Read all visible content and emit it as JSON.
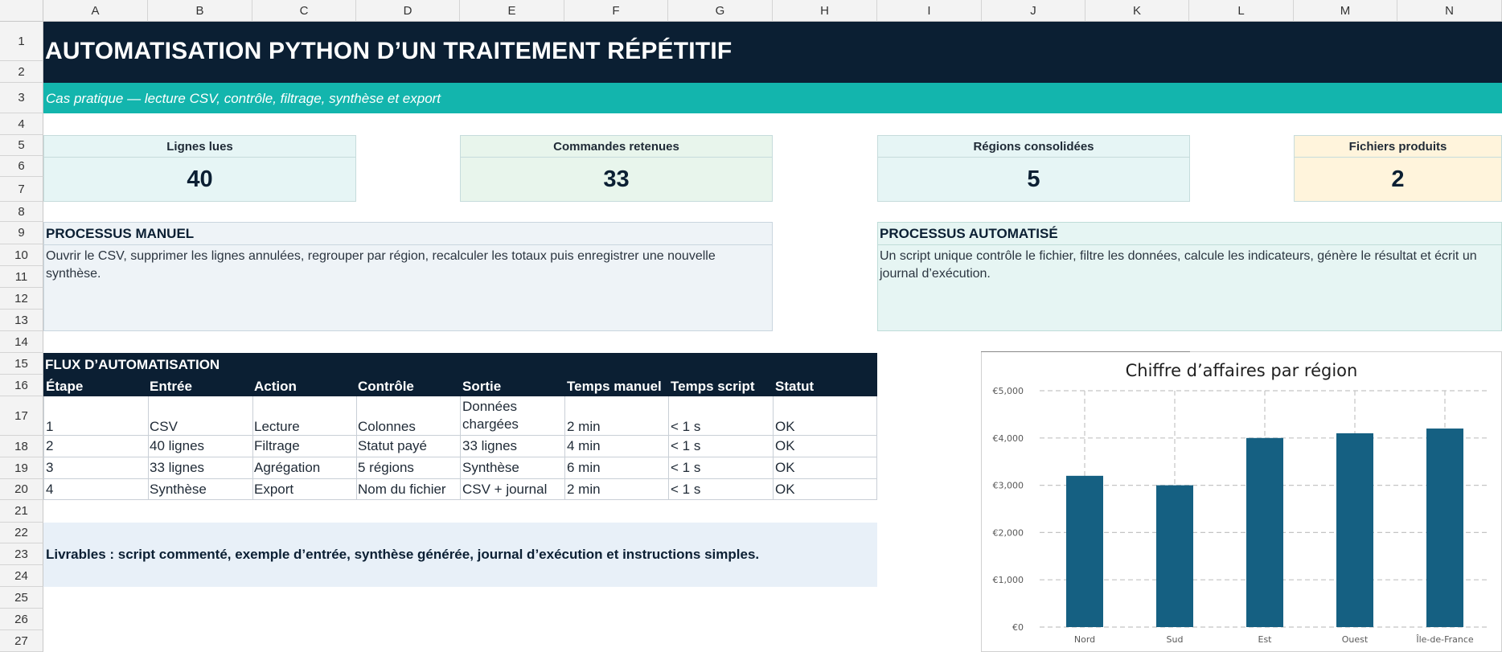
{
  "columns": [
    "A",
    "B",
    "C",
    "D",
    "E",
    "F",
    "G",
    "H",
    "I",
    "J",
    "K",
    "L",
    "M",
    "N"
  ],
  "rows": [
    "1",
    "2",
    "3",
    "4",
    "5",
    "6",
    "7",
    "8",
    "9",
    "10",
    "11",
    "12",
    "13",
    "14",
    "15",
    "16",
    "17",
    "18",
    "19",
    "20",
    "21",
    "22",
    "23",
    "24",
    "25",
    "26",
    "27"
  ],
  "title": "AUTOMATISATION PYTHON D’UN TRAITEMENT RÉPÉTITIF",
  "subtitle": "Cas pratique — lecture CSV, contrôle, filtrage, synthèse et export",
  "kpis": [
    {
      "label": "Lignes lues",
      "value": "40"
    },
    {
      "label": "Commandes retenues",
      "value": "33"
    },
    {
      "label": "Régions consolidées",
      "value": "5"
    },
    {
      "label": "Fichiers produits",
      "value": "2"
    }
  ],
  "manual": {
    "title": "PROCESSUS MANUEL",
    "body": "Ouvrir le CSV, supprimer les lignes annulées, regrouper par région, recalculer les totaux puis enregistrer une nouvelle synthèse."
  },
  "auto": {
    "title": "PROCESSUS AUTOMATISÉ",
    "body": "Un script unique contrôle le fichier, filtre les données, calcule les indicateurs, génère le résultat et écrit un journal d’exécution."
  },
  "flux": {
    "title": "FLUX D’AUTOMATISATION",
    "headers": [
      "Étape",
      "Entrée",
      "Action",
      "Contrôle",
      "Sortie",
      "Temps manuel",
      "Temps script",
      "Statut"
    ],
    "rows": [
      [
        "1",
        "CSV",
        "Lecture",
        "Colonnes",
        "Données chargées",
        "2 min",
        "< 1 s",
        "OK"
      ],
      [
        "2",
        "40 lignes",
        "Filtrage",
        "Statut payé",
        "33 lignes",
        "4 min",
        "< 1 s",
        "OK"
      ],
      [
        "3",
        "33 lignes",
        "Agrégation",
        "5 régions",
        "Synthèse",
        "6 min",
        "< 1 s",
        "OK"
      ],
      [
        "4",
        "Synthèse",
        "Export",
        "Nom du fichier",
        "CSV + journal",
        "2 min",
        "< 1 s",
        "OK"
      ]
    ]
  },
  "livrables": "Livrables : script commenté, exemple d’entrée, synthèse générée, journal d’exécution et instructions simples.",
  "colors": {
    "navy": "#0b1f33",
    "teal": "#13b5ad",
    "bar": "#156082",
    "kpi_bg": [
      "#e6f5f5",
      "#e8f5ec",
      "#e6f5f5",
      "#fff4dc"
    ],
    "manual_bg": "#eef3f7",
    "auto_bg": "#e6f5f3"
  },
  "chart_data": {
    "type": "bar",
    "title": "Chiffre d’affaires par région",
    "categories": [
      "Nord",
      "Sud",
      "Est",
      "Ouest",
      "Île-de-France"
    ],
    "values": [
      3200,
      3000,
      4000,
      4100,
      4200
    ],
    "ylim": [
      0,
      5000
    ],
    "yticks": [
      0,
      1000,
      2000,
      3000,
      4000,
      5000
    ],
    "ytick_labels": [
      "€0",
      "€1,000",
      "€2,000",
      "€3,000",
      "€4,000",
      "€5,000"
    ],
    "grid": true,
    "legend": "none"
  }
}
